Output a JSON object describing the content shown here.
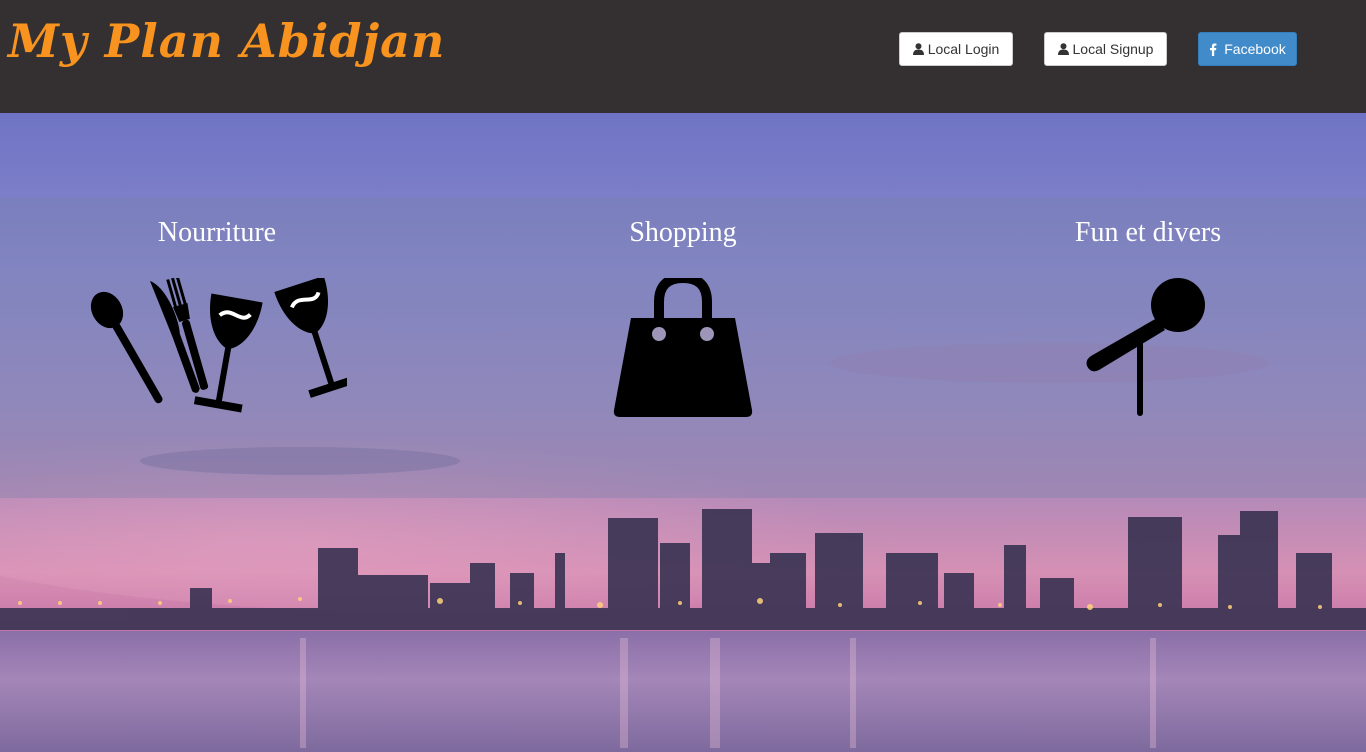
{
  "header": {
    "brand": "My Plan Abidjan",
    "buttons": {
      "login": "Local Login",
      "signup": "Local Signup",
      "facebook": "Facebook"
    }
  },
  "categories": [
    {
      "title": "Nourriture",
      "icon": "cutlery-and-wine-glasses-icon"
    },
    {
      "title": "Shopping",
      "icon": "shopping-bag-icon"
    },
    {
      "title": "Fun et divers",
      "icon": "microphone-icon"
    }
  ],
  "colors": {
    "navbar": "#343031",
    "brand": "#f7931e",
    "facebook": "#428bca"
  }
}
